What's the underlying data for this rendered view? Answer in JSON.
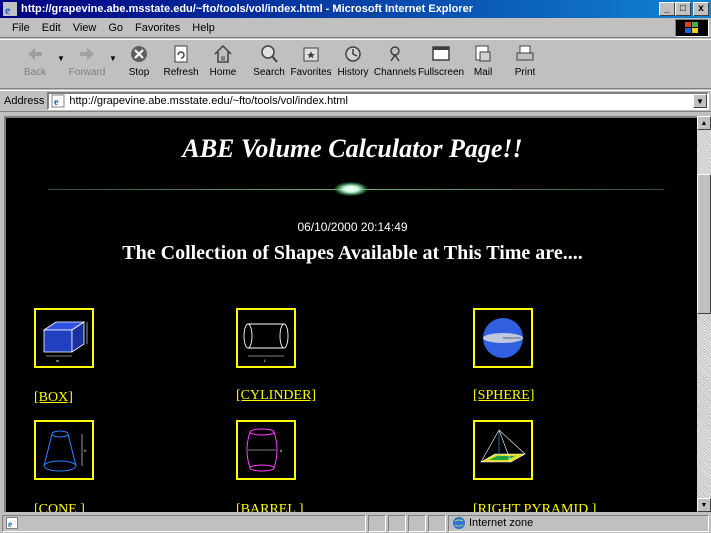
{
  "window": {
    "title": "http://grapevine.abe.msstate.edu/~fto/tools/vol/index.html - Microsoft Internet Explorer",
    "minimize": "_",
    "maximize": "□",
    "close": "x"
  },
  "menu": {
    "items": [
      "File",
      "Edit",
      "View",
      "Go",
      "Favorites",
      "Help"
    ]
  },
  "toolbar": {
    "back": "Back",
    "forward": "Forward",
    "stop": "Stop",
    "refresh": "Refresh",
    "home": "Home",
    "search": "Search",
    "favorites": "Favorites",
    "history": "History",
    "channels": "Channels",
    "fullscreen": "Fullscreen",
    "mail": "Mail",
    "print": "Print"
  },
  "address": {
    "label": "Address",
    "url": "http://grapevine.abe.msstate.edu/~fto/tools/vol/index.html"
  },
  "page": {
    "title": "ABE Volume Calculator Page!!",
    "timestamp": "06/10/2000 20:14:49",
    "subheading": "The Collection of Shapes Available at This Time are....",
    "shapes": [
      {
        "label": "[BOX]",
        "icon": "box-icon"
      },
      {
        "label": "[CYLINDER]",
        "icon": "cylinder-icon"
      },
      {
        "label": "[SPHERE]",
        "icon": "sphere-icon"
      },
      {
        "label": "[CONE ]",
        "icon": "cone-icon"
      },
      {
        "label": "[BARREL ]",
        "icon": "barrel-icon"
      },
      {
        "label": "[RIGHT PYRAMID ]",
        "icon": "pyramid-icon"
      }
    ]
  },
  "status": {
    "zone": "Internet zone"
  },
  "colors": {
    "page_bg": "#000000",
    "link": "#ffff00",
    "title_bar": "#000080"
  }
}
